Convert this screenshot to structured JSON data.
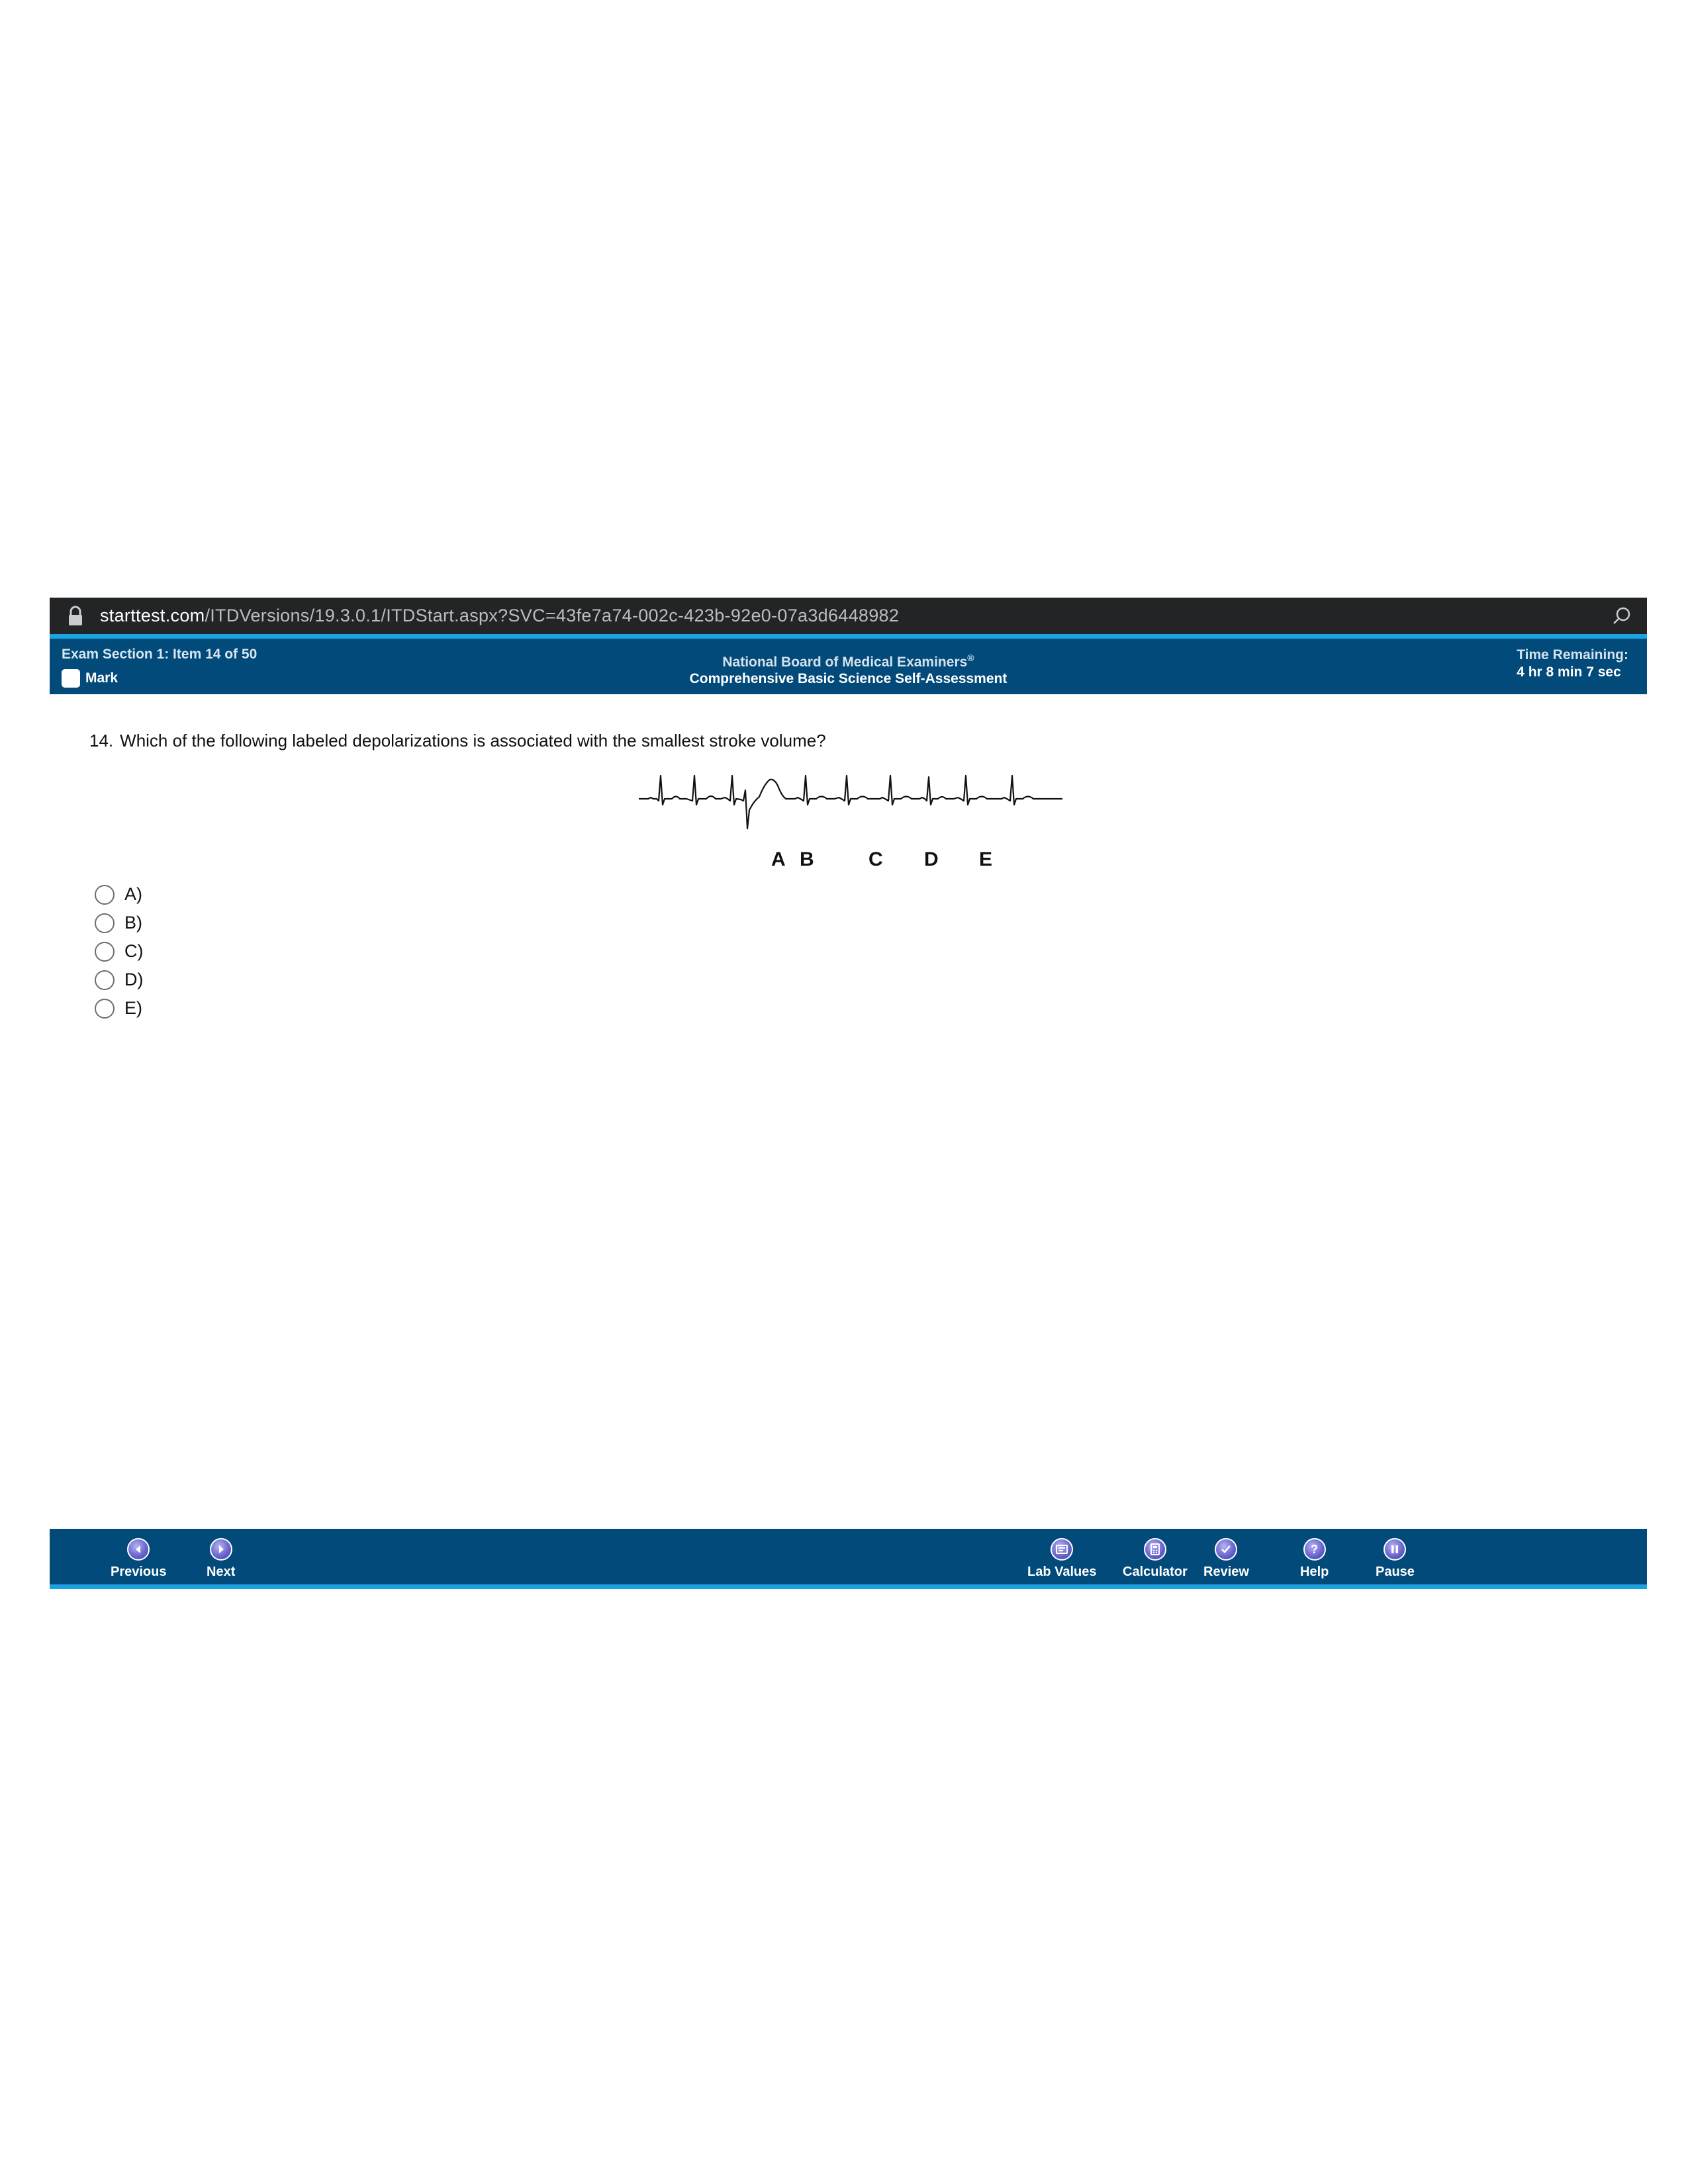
{
  "browser": {
    "url_host": "starttest.com",
    "url_path": "/ITDVersions/19.3.0.1/ITDStart.aspx?SVC=43fe7a74-002c-423b-92e0-07a3d6448982",
    "icons": {
      "lock": "lock-icon",
      "zoom": "zoom-icon"
    }
  },
  "header": {
    "item_info": "Exam Section 1: Item 14 of 50",
    "mark_label": "Mark",
    "org_name": "National Board of Medical Examiners",
    "org_mark": "®",
    "exam_title": "Comprehensive Basic Science Self-Assessment",
    "time_label": "Time Remaining:",
    "time_value": "4 hr 8 min 7 sec"
  },
  "question": {
    "number": "14.",
    "text": "Which of the following labeled depolarizations is associated with the smallest stroke volume?",
    "ecg_labels": [
      "A",
      "B",
      "C",
      "D",
      "E"
    ]
  },
  "answers": [
    {
      "label": "A)",
      "selected": false
    },
    {
      "label": "B)",
      "selected": false
    },
    {
      "label": "C)",
      "selected": false
    },
    {
      "label": "D)",
      "selected": false
    },
    {
      "label": "E)",
      "selected": false
    }
  ],
  "footer": {
    "previous": "Previous",
    "next": "Next",
    "lab_values": "Lab Values",
    "calculator": "Calculator",
    "review": "Review",
    "help": "Help",
    "pause": "Pause"
  },
  "colors": {
    "header_bg": "#014a7a",
    "accent_line": "#1aa3e0",
    "urlbar_bg": "#222426",
    "nav_icon": "#6a66cf"
  }
}
